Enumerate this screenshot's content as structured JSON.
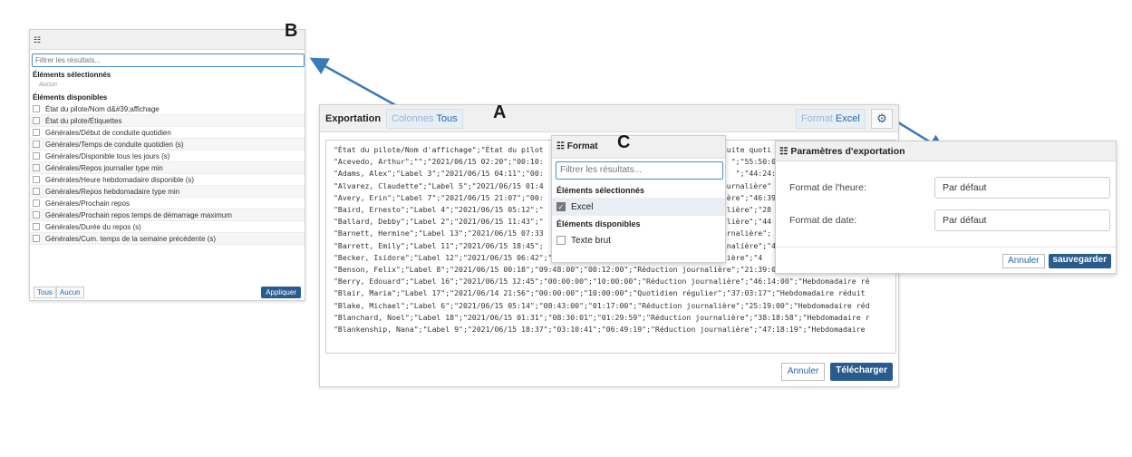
{
  "labels": {
    "a": "A",
    "b": "B",
    "c": "C"
  },
  "column_panel": {
    "filter_placeholder": "Filtrer les résultats...",
    "selected_header": "Éléments sélectionnés",
    "selected_empty": "Aucun",
    "available_header": "Éléments disponibles",
    "items": [
      "État du pilote/Nom d&#39;affichage",
      "État du pilote/Étiquettes",
      "Générales/Début de conduite quotidien",
      "Générales/Temps de conduite quotidien (s)",
      "Générales/Disponible tous les jours (s)",
      "Générales/Repos journalier type min",
      "Générales/Heure hebdomadaire disponible (s)",
      "Générales/Repos hebdomadaire type min",
      "Générales/Prochain repos",
      "Générales/Prochain repos temps de démarrage maximum",
      "Générales/Durée du repos (s)",
      "Générales/Cum. temps de la semaine précédente (s)"
    ],
    "all_label": "Tous",
    "none_label": "Aucun",
    "apply_label": "Appliquer"
  },
  "export_panel": {
    "title": "Exportation",
    "columns_label": "Colonnes",
    "columns_value": "Tous",
    "format_label": "Format",
    "format_value": "Excel",
    "preview_lines": [
      "\"État du pilote/Nom d'affichage\";\"État du pilot                                        duite quoti",
      "\"Acevedo, Arthur\";\"\";\"2021/06/15 02:20\";\"00:10:                                          \";\"55:50:00\"",
      "\"Adams, Alex\";\"Label 3\";\"2021/06/15 04:11\";\"00:                                           \";\"44:24:00\"",
      "\"Alvarez, Claudette\";\"Label 5\";\"2021/06/15 01:4                                        ournalière\"",
      "\"Avery, Erin\";\"Label 7\";\"2021/06/15 21:07\";\"00:                                         ère\";\"46:39",
      "\"Baird, Ernesto\";\"Label 4\";\"2021/06/15 05:12\";\"                                         lière\";\"28",
      "\"Ballard, Debby\";\"Label 2\";\"2021/06/15 11:43\";\"                                         lière\";\"44",
      "\"Barnett, Hermine\";\"Label 13\";\"2021/06/15 07:33                                        urnalière\";",
      "\"Barrett, Emily\";\"Label 11\";\"2021/06/15 18:45\";                                         nalière\";\"4",
      "\"Becker, Isidore\";\"Label 12\";\"2021/06/15 06:42\";\"08:09:41\";\"01:50:19\";\"Réduction journalière\";\"4",
      "\"Benson, Felix\";\"Label 8\";\"2021/06/15 00:18\";\"09:48:00\";\"00:12:00\";\"Réduction journalière\";\"21:39:00\";\"Hebdomadaire régi",
      "\"Berry, Edouard\";\"Label 16\";\"2021/06/15 12:45\";\"00:00:00\";\"10:00:00\";\"Réduction journalière\";\"46:14:00\";\"Hebdomadaire ré",
      "\"Blair, Maria\";\"Label 17\";\"2021/06/14 21:56\";\"00:00:00\";\"10:00:00\";\"Quotidien régulier\";\"37:03:17\";\"Hebdomadaire réduit",
      "\"Blake, Michael\";\"Label 6\";\"2021/06/15 05:14\";\"08:43:00\";\"01:17:00\";\"Réduction journalière\";\"25:19:00\";\"Hebdomadaire réd",
      "\"Blanchard, Noel\";\"Label 18\";\"2021/06/15 01:31\";\"08:30:01\";\"01:29:59\";\"Réduction journalière\";\"38:18:58\";\"Hebdomadaire r",
      "\"Blankenship, Nana\";\"Label 9\";\"2021/06/15 18:37\";\"03:10:41\";\"06:49:19\";\"Réduction journalière\";\"47:18:19\";\"Hebdomadaire"
    ],
    "cancel_label": "Annuler",
    "download_label": "Télécharger"
  },
  "format_panel": {
    "title": "Format",
    "filter_placeholder": "Filtrer les résultats...",
    "selected_header": "Éléments sélectionnés",
    "selected_item": "Excel",
    "available_header": "Éléments disponibles",
    "available_item": "Texte brut"
  },
  "settings_panel": {
    "title": "Paramètres d'exportation",
    "time_format_label": "Format de l'heure:",
    "time_format_value": "Par défaut",
    "date_format_label": "Format de date:",
    "date_format_value": "Par défaut",
    "cancel_label": "Annuler",
    "save_label": "sauvegarder"
  },
  "colors": {
    "accent": "#2a66a8",
    "primary": "#2a5b8f",
    "arrow": "#3a7ab8"
  }
}
